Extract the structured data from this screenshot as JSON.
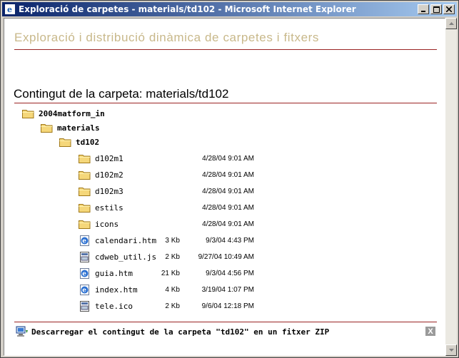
{
  "window": {
    "title": "Exploració de carpetes - materials/td102 - Microsoft Internet Explorer",
    "buttons": {
      "minimize": "_",
      "maximize": "□",
      "close": "X"
    }
  },
  "page": {
    "banner": "Exploració i distribució dinàmica de carpetes i fitxers",
    "heading": "Contingut de la carpeta: materials/td102",
    "tree": [
      {
        "label": "2004matform_in",
        "icon": "folder-icon"
      },
      {
        "label": "materials",
        "icon": "folder-icon"
      },
      {
        "label": "td102",
        "icon": "folder-icon"
      }
    ],
    "entries": [
      {
        "name": "d102m1",
        "icon": "folder-icon",
        "size": "",
        "date": "4/28/04 9:01 AM"
      },
      {
        "name": "d102m2",
        "icon": "folder-icon",
        "size": "",
        "date": "4/28/04 9:01 AM"
      },
      {
        "name": "d102m3",
        "icon": "folder-icon",
        "size": "",
        "date": "4/28/04 9:01 AM"
      },
      {
        "name": "estils",
        "icon": "folder-icon",
        "size": "",
        "date": "4/28/04 9:01 AM"
      },
      {
        "name": "icons",
        "icon": "folder-icon",
        "size": "",
        "date": "4/28/04 9:01 AM"
      },
      {
        "name": "calendari.htm",
        "icon": "ie-document-icon",
        "size": "3 Kb",
        "date": "9/3/04 4:43 PM"
      },
      {
        "name": "cdweb_util.js",
        "icon": "script-file-icon",
        "size": "2 Kb",
        "date": "9/27/04 10:49 AM"
      },
      {
        "name": "guia.htm",
        "icon": "ie-document-icon",
        "size": "21 Kb",
        "date": "9/3/04 4:56 PM"
      },
      {
        "name": "index.htm",
        "icon": "ie-document-icon",
        "size": "4 Kb",
        "date": "3/19/04 1:07 PM"
      },
      {
        "name": "tele.ico",
        "icon": "script-file-icon",
        "size": "2 Kb",
        "date": "9/6/04 12:18 PM"
      }
    ],
    "footer": {
      "download_text": "Descarregar el contingut de la carpeta \"td102\" en un fitxer ZIP",
      "close_label": "X"
    }
  },
  "colors": {
    "accent_rule": "#9b2424",
    "banner_text": "#c8b88a",
    "titlebar_start": "#0a246a",
    "titlebar_end": "#a6caf0"
  }
}
